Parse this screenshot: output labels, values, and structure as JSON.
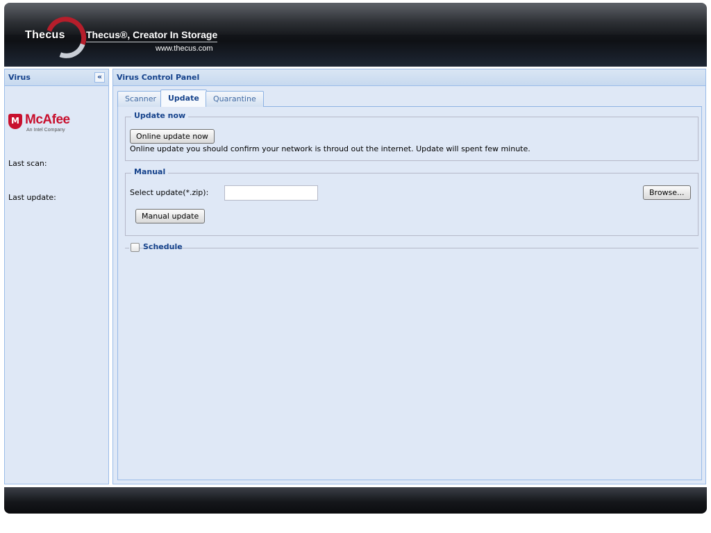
{
  "header": {
    "logo_text": "Thecus",
    "tagline": "Thecus®, Creator In Storage",
    "website": "www.thecus.com"
  },
  "sidebar": {
    "title": "Virus",
    "collapse_symbol": "«",
    "brand": {
      "name": "McAfee",
      "shield_letter": "M",
      "subtitle": "An Intel Company"
    },
    "last_scan_label": "Last scan:",
    "last_update_label": "Last update:"
  },
  "main": {
    "title": "Virus Control Panel",
    "tabs": [
      {
        "label": "Scanner",
        "active": false
      },
      {
        "label": "Update",
        "active": true
      },
      {
        "label": "Quarantine",
        "active": false
      }
    ],
    "update_now": {
      "legend": "Update now",
      "button_label": "Online update now",
      "description": "Online update you should confirm your network is throud out the internet. Update will spent few minute."
    },
    "manual": {
      "legend": "Manual",
      "select_label": "Select update(*.zip):",
      "file_value": "",
      "browse_label": "Browse...",
      "manual_update_label": "Manual update"
    },
    "schedule": {
      "label": "Schedule",
      "checked": false
    }
  },
  "colors": {
    "panel_bg": "#dfe8f6",
    "panel_border": "#99bbe8",
    "title_text": "#15428b",
    "brand_red": "#c8102e"
  },
  "icons": {
    "collapse": "double-chevron-left-icon",
    "brand": "mcafee-shield-icon",
    "logo": "thecus-swoosh-icon"
  }
}
